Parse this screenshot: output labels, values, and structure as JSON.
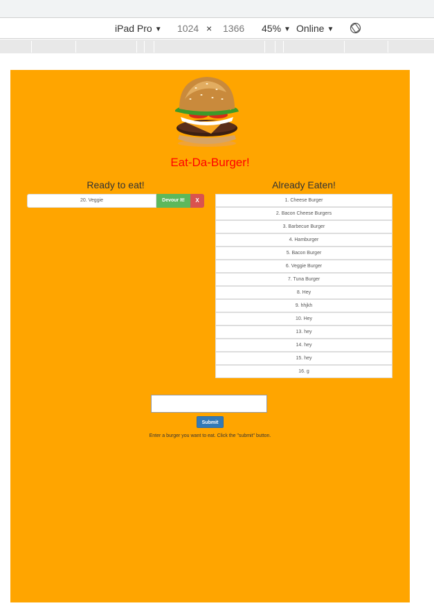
{
  "devtools": {
    "device": "iPad Pro",
    "width": "1024",
    "times": "×",
    "height": "1366",
    "zoom": "45%",
    "network": "Online",
    "dropdown_glyph": "▼",
    "rotate_icon": "rotate-icon"
  },
  "site": {
    "title": "Eat-Da-Burger!",
    "logo_icon": "burger-logo",
    "ready_heading": "Ready to eat!",
    "eaten_heading": "Already Eaten!",
    "ready": [
      {
        "name": "20. Veggie",
        "devour_label": "Devour It!",
        "delete_label": "X"
      }
    ],
    "eaten": [
      "1. Cheese Burger",
      "2. Bacon Cheese Burgers",
      "3. Barbecue Burger",
      "4. Hamburger",
      "5. Bacon Burger",
      "6. Veggie Burger",
      "7. Tuna Burger",
      "8. Hey",
      "9. hhjkh",
      "10. Hey",
      "13. hey",
      "14. hey",
      "15. hey",
      "16. g"
    ],
    "input_value": "",
    "submit_label": "Submit",
    "help_text": "Enter a burger you want to eat. Click the \"submit\" button."
  },
  "colors": {
    "page_bg": "#ffa500",
    "title": "#ff0000",
    "devour": "#5cb85c",
    "delete": "#d9534f",
    "submit": "#337ab7"
  }
}
